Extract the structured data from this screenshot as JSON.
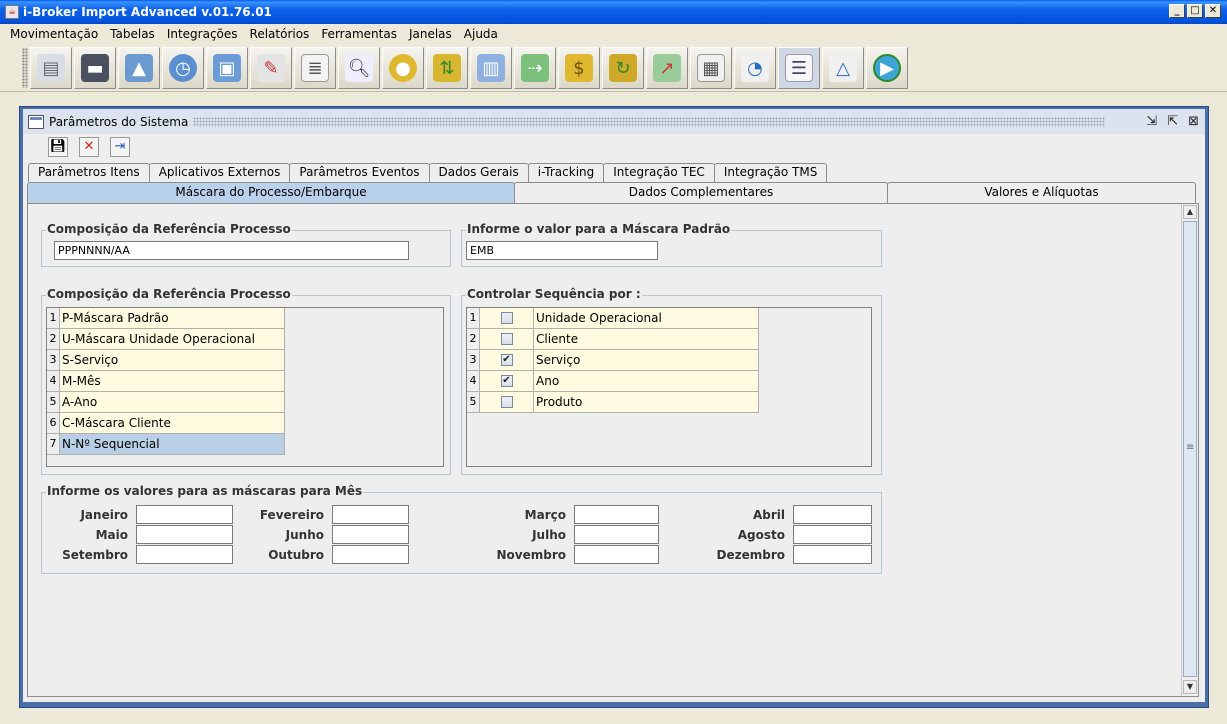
{
  "window": {
    "title": "i-Broker Import Advanced v.01.76.01"
  },
  "menu": [
    "Movimentação",
    "Tabelas",
    "Integrações",
    "Relatórios",
    "Ferramentas",
    "Janelas",
    "Ajuda"
  ],
  "toolbar_icons": [
    "documents-icon",
    "cabinet-icon",
    "image-icon",
    "clock-icon",
    "window-icon",
    "edit-icon",
    "report-icon",
    "search-icon",
    "coins-icon",
    "money-exchange-icon",
    "notes-icon",
    "money-transfer-icon",
    "banknote-icon",
    "money-cycle-icon",
    "chart-growth-icon",
    "sheet-report-icon",
    "pie-chart-icon",
    "list-doc-icon",
    "geometry-icon",
    "play-icon"
  ],
  "frame": {
    "title": "Parâmetros do Sistema",
    "tabs_row1": [
      "Parâmetros Itens",
      "Aplicativos Externos",
      "Parâmetros Eventos",
      "Dados Gerais",
      "i-Tracking",
      "Integração TEC",
      "Integração TMS"
    ],
    "tabs_row2": [
      "Máscara do Processo/Embarque",
      "Dados Complementares",
      "Valores e Alíquotas"
    ],
    "active_tab": "Máscara do Processo/Embarque"
  },
  "composicao": {
    "legend": "Composição da Referência Processo",
    "value": "PPPNNNN/AA"
  },
  "mascara_padrao": {
    "legend": "Informe o valor para a Máscara Padrão",
    "value": "EMB"
  },
  "composicao_list": {
    "legend": "Composição da Referência Processo",
    "items": [
      {
        "n": "1",
        "label": "P-Máscara Padrão"
      },
      {
        "n": "2",
        "label": "U-Máscara Unidade Operacional"
      },
      {
        "n": "3",
        "label": "S-Serviço"
      },
      {
        "n": "4",
        "label": "M-Mês"
      },
      {
        "n": "5",
        "label": "A-Ano"
      },
      {
        "n": "6",
        "label": "C-Máscara Cliente"
      },
      {
        "n": "7",
        "label": "N-Nº Sequencial"
      }
    ],
    "selected": 7
  },
  "sequencia": {
    "legend": "Controlar Sequência por :",
    "items": [
      {
        "n": "1",
        "label": "Unidade Operacional",
        "checked": false
      },
      {
        "n": "2",
        "label": "Cliente",
        "checked": false
      },
      {
        "n": "3",
        "label": "Serviço",
        "checked": true
      },
      {
        "n": "4",
        "label": "Ano",
        "checked": true
      },
      {
        "n": "5",
        "label": "Produto",
        "checked": false
      }
    ]
  },
  "meses": {
    "legend": "Informe os valores para as máscaras para Mês",
    "labels": [
      "Janeiro",
      "Fevereiro",
      "Março",
      "Abril",
      "Maio",
      "Junho",
      "Julho",
      "Agosto",
      "Setembro",
      "Outubro",
      "Novembro",
      "Dezembro"
    ],
    "values": [
      "",
      "",
      "",
      "",
      "",
      "",
      "",
      "",
      "",
      "",
      "",
      ""
    ]
  }
}
